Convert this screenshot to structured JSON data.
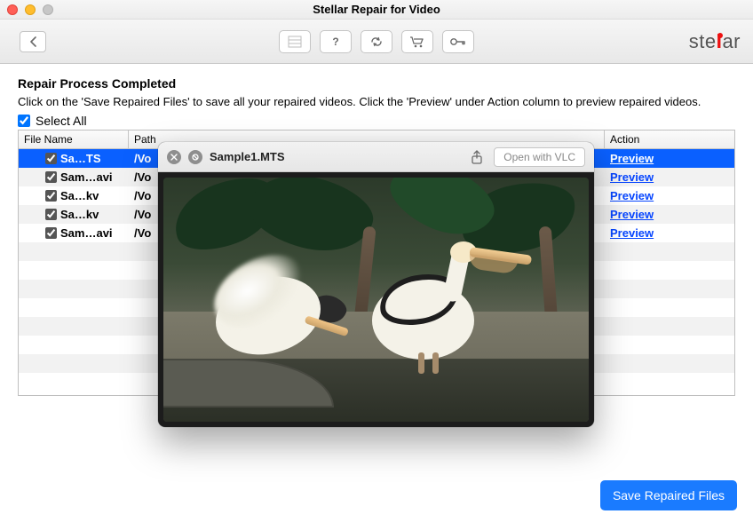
{
  "window": {
    "title": "Stellar Repair for Video"
  },
  "logo": {
    "text_prefix": "ste",
    "text_mid": "l",
    "text_suffix": "ar"
  },
  "toolbar": {
    "icons": [
      "list-icon",
      "help-icon",
      "refresh-icon",
      "cart-icon",
      "key-icon"
    ]
  },
  "heading": "Repair Process Completed",
  "subtext": "Click on the 'Save Repaired Files' to save all your repaired videos. Click the 'Preview' under Action column to preview repaired videos.",
  "select_all_label": "Select All",
  "columns": {
    "file": "File Name",
    "path": "Path",
    "action": "Action"
  },
  "rows": [
    {
      "file": "Sa…TS",
      "path": "/Vo",
      "action": "Preview",
      "checked": true,
      "selected": true
    },
    {
      "file": "Sam…avi",
      "path": "/Vo",
      "action": "Preview",
      "checked": true,
      "selected": false
    },
    {
      "file": "Sa…kv",
      "path": "/Vo",
      "action": "Preview",
      "checked": true,
      "selected": false
    },
    {
      "file": "Sa…kv",
      "path": "/Vo",
      "action": "Preview",
      "checked": true,
      "selected": false
    },
    {
      "file": "Sam…avi",
      "path": "/Vo",
      "action": "Preview",
      "checked": true,
      "selected": false
    }
  ],
  "save_button": "Save Repaired Files",
  "preview": {
    "filename": "Sample1.MTS",
    "open_with": "Open with VLC",
    "image_desc": "Two white pelicans near a stone basin with green foliage"
  }
}
